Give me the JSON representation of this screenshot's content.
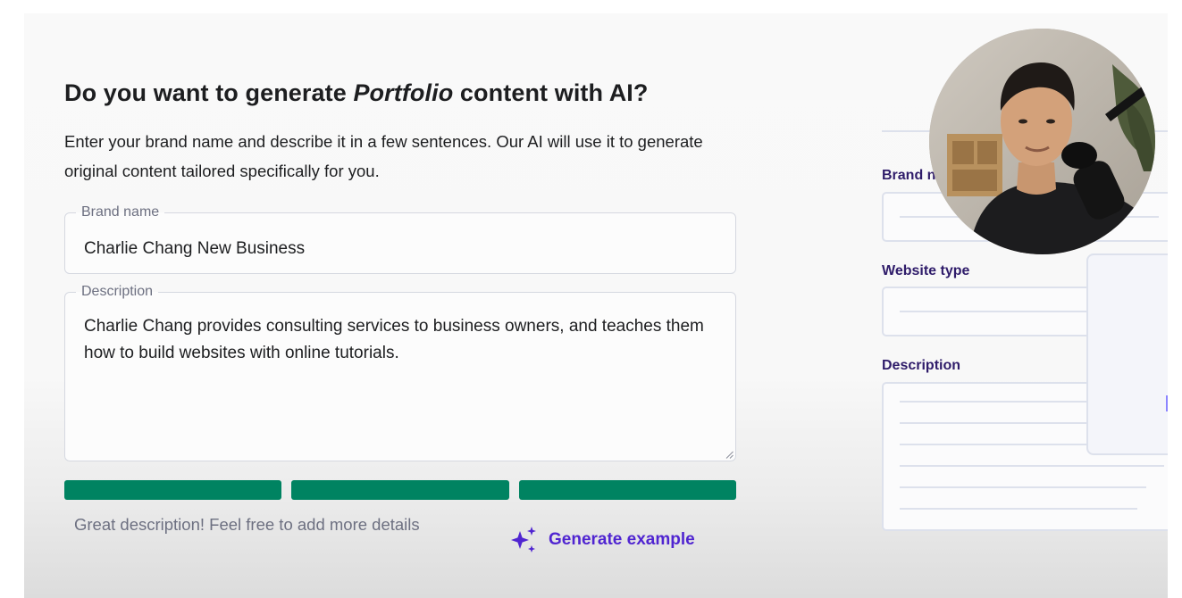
{
  "heading": {
    "before": "Do you want to generate ",
    "emphasis": "Portfolio",
    "after": " content with AI?"
  },
  "subtitle": "Enter your brand name and describe it in a few sentences. Our AI will use it to generate original content tailored specifically for you.",
  "brand_field": {
    "label": "Brand name",
    "value": "Charlie Chang New Business"
  },
  "description_field": {
    "label": "Description",
    "value": "Charlie Chang provides consulting services to business owners, and teaches them how to build websites with online tutorials."
  },
  "strength_meter": {
    "segments_filled": 3,
    "segments_total": 3,
    "color": "#008361"
  },
  "hint": "Great description! Feel free to add more details",
  "generate_button": {
    "label": "Generate example",
    "icon": "sparkles-icon",
    "color": "#5025d1"
  },
  "preview": {
    "brand_label": "Brand n",
    "website_type_label": "Website type",
    "description_label": "Description"
  },
  "webcam": {
    "icon": "presenter-avatar"
  }
}
